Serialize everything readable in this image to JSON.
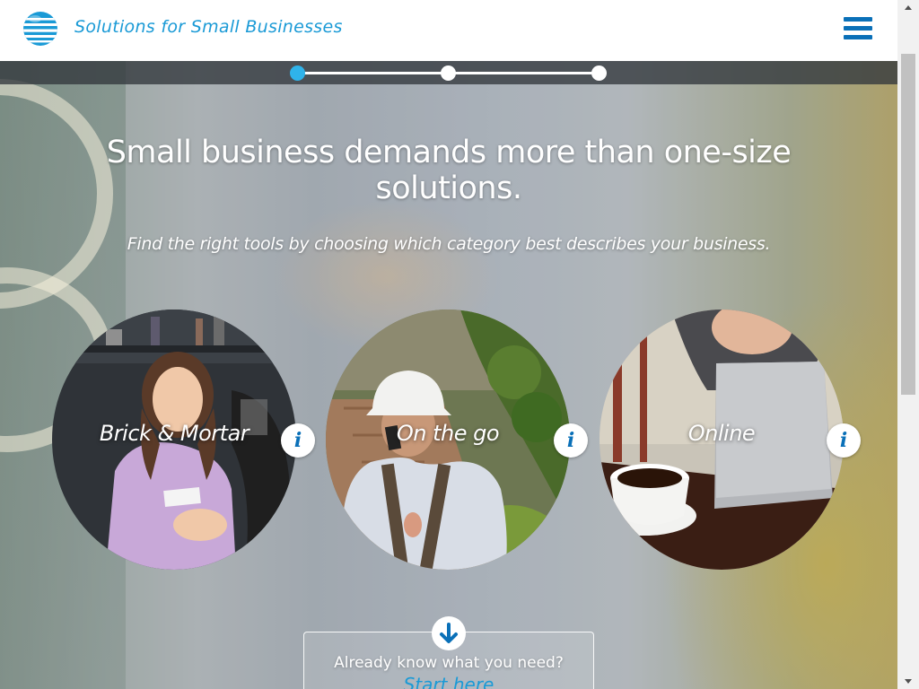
{
  "header": {
    "brand_text": "Solutions for Small Businesses",
    "logo_icon": "att-globe-icon",
    "menu_icon": "hamburger-menu-icon",
    "colors": {
      "brand": "#1a9ad6",
      "menu": "#0a70b8"
    }
  },
  "progress": {
    "steps": 3,
    "active_step": 1,
    "colors": {
      "active": "#2fb3ea",
      "inactive": "#ffffff"
    }
  },
  "hero": {
    "headline": "Small business demands more than one-size solutions.",
    "subhead": "Find the right tools by choosing which category best describes your business."
  },
  "categories": [
    {
      "label": "Brick & Mortar",
      "info_icon": "info-icon"
    },
    {
      "label": "On the go",
      "info_icon": "info-icon"
    },
    {
      "label": "Online",
      "info_icon": "info-icon"
    }
  ],
  "info_glyph": "i",
  "cta": {
    "question": "Already know what you need?",
    "link": "Start here",
    "arrow_icon": "arrow-down-icon"
  }
}
